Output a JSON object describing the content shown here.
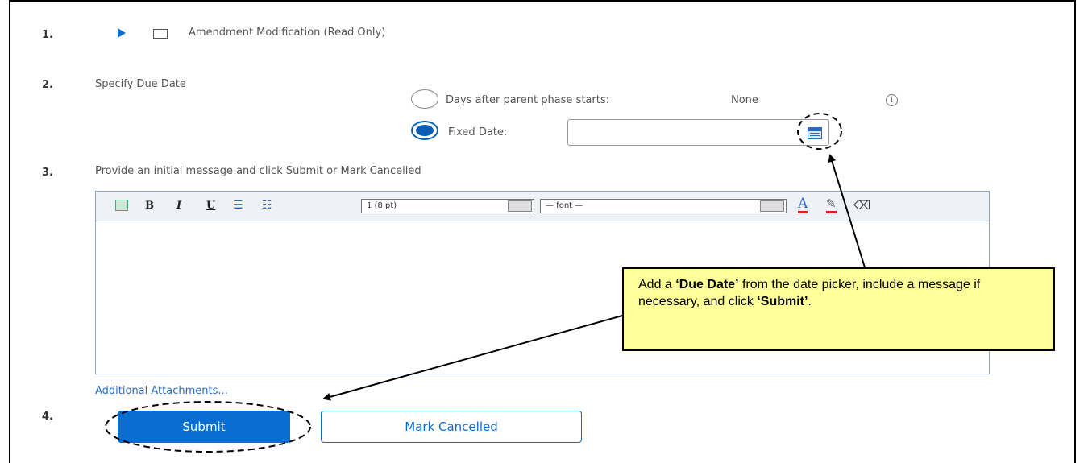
{
  "steps": {
    "s1": {
      "num": "1.",
      "label": "Amendment Modification (Read Only)"
    },
    "s2": {
      "num": "2.",
      "label": "Specify Due Date",
      "radio_days_label": "Days after parent phase starts:",
      "radio_days_value": "None",
      "radio_fixed_label": "Fixed Date:",
      "fixed_date_value": "",
      "selected": "fixed"
    },
    "s3": {
      "num": "3.",
      "label": "Provide an initial message and click Submit or Mark Cancelled"
    },
    "s4": {
      "num": "4."
    }
  },
  "toolbar": {
    "bold": "B",
    "italic": "I",
    "underline": "U",
    "size_select": "1 (8 pt)",
    "font_select": "— font —"
  },
  "editor_content": "",
  "attachments_link": "Additional Attachments...",
  "buttons": {
    "submit": "Submit",
    "cancel": "Mark Cancelled"
  },
  "callout": {
    "part1": "Add a ",
    "bold1": "‘Due Date’",
    "part2": " from the date picker, include a message if necessary, and click ",
    "bold2": "‘Submit’",
    "part3": "."
  },
  "colors": {
    "accent": "#0a6ed1",
    "callout_bg": "#ffff99",
    "link": "#2a6dbf"
  },
  "icons": [
    "expand-arrow-icon",
    "checkbox-icon",
    "info-icon",
    "calendar-icon",
    "insert-image-icon",
    "numbered-list-icon",
    "bulleted-list-icon",
    "font-color-icon",
    "highlight-color-icon",
    "eraser-icon"
  ]
}
